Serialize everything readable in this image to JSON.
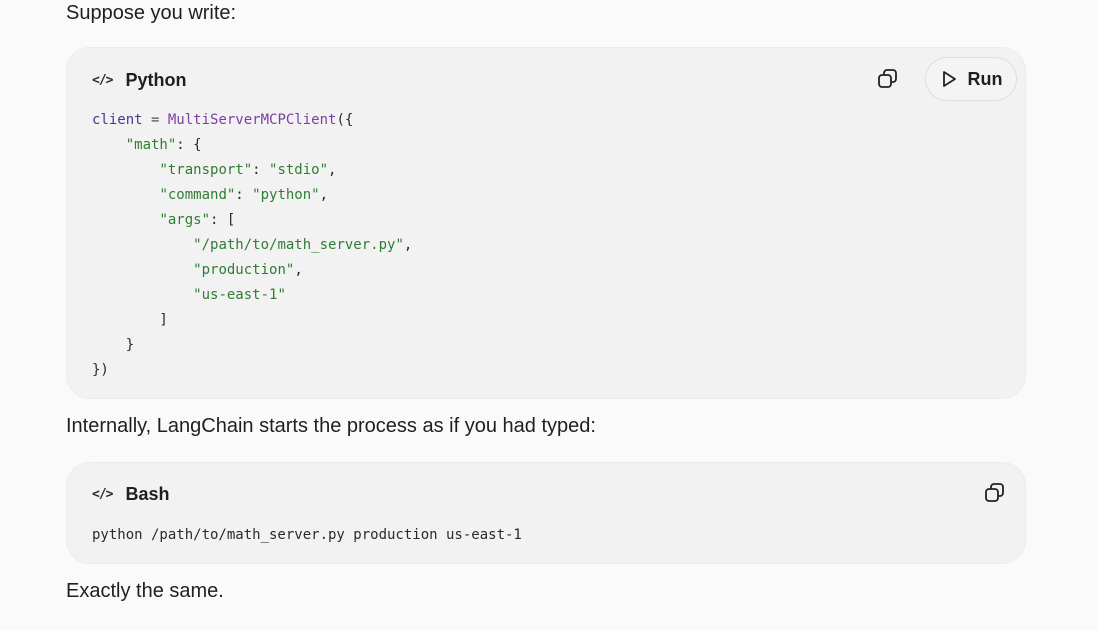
{
  "intro_text": "Suppose you write:",
  "middle_text": "Internally, LangChain starts the process as if you had typed:",
  "outro_text": "Exactly the same.",
  "python_block": {
    "lang_icon": "</>",
    "language": "Python",
    "run_label": "Run",
    "icons": {
      "lang": "code-icon",
      "copy": "copy-icon",
      "run": "play-icon"
    },
    "lines": [
      [
        {
          "t": "client",
          "c": "ident"
        },
        {
          "t": " = ",
          "c": "op"
        },
        {
          "t": "MultiServerMCPClient",
          "c": "cls"
        },
        {
          "t": "({",
          "c": "punc"
        }
      ],
      [
        {
          "t": "    ",
          "c": "punc"
        },
        {
          "t": "\"math\"",
          "c": "key"
        },
        {
          "t": ": {",
          "c": "punc"
        }
      ],
      [
        {
          "t": "        ",
          "c": "punc"
        },
        {
          "t": "\"transport\"",
          "c": "key"
        },
        {
          "t": ": ",
          "c": "punc"
        },
        {
          "t": "\"stdio\"",
          "c": "str"
        },
        {
          "t": ",",
          "c": "punc"
        }
      ],
      [
        {
          "t": "        ",
          "c": "punc"
        },
        {
          "t": "\"command\"",
          "c": "key"
        },
        {
          "t": ": ",
          "c": "punc"
        },
        {
          "t": "\"python\"",
          "c": "str"
        },
        {
          "t": ",",
          "c": "punc"
        }
      ],
      [
        {
          "t": "        ",
          "c": "punc"
        },
        {
          "t": "\"args\"",
          "c": "key"
        },
        {
          "t": ": [",
          "c": "punc"
        }
      ],
      [
        {
          "t": "            ",
          "c": "punc"
        },
        {
          "t": "\"/path/to/math_server.py\"",
          "c": "str"
        },
        {
          "t": ",",
          "c": "punc"
        }
      ],
      [
        {
          "t": "            ",
          "c": "punc"
        },
        {
          "t": "\"production\"",
          "c": "str"
        },
        {
          "t": ",",
          "c": "punc"
        }
      ],
      [
        {
          "t": "            ",
          "c": "punc"
        },
        {
          "t": "\"us-east-1\"",
          "c": "str"
        }
      ],
      [
        {
          "t": "        ]",
          "c": "punc"
        }
      ],
      [
        {
          "t": "    }",
          "c": "punc"
        }
      ],
      [
        {
          "t": "})",
          "c": "punc"
        }
      ]
    ]
  },
  "bash_block": {
    "lang_icon": "</>",
    "language": "Bash",
    "icons": {
      "lang": "code-icon",
      "copy": "copy-icon"
    },
    "lines": [
      [
        {
          "t": "python /path/to/math_server.py production us-east-1",
          "c": "punc"
        }
      ]
    ]
  }
}
